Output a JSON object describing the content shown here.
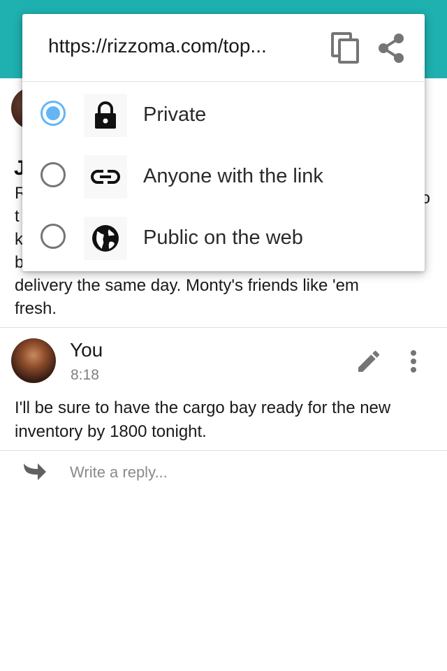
{
  "colors": {
    "appbar": "#1fb0b0",
    "radio_selected": "#64b5f6",
    "radio_unselected": "#757575",
    "icon_dark": "#111111",
    "icon_grey": "#757575"
  },
  "share_popup": {
    "url_display": "https://rizzoma.com/top...",
    "copy_icon": "copy-icon",
    "share_icon": "share-icon",
    "options": [
      {
        "label": "Private",
        "icon": "lock-icon",
        "selected": true
      },
      {
        "label": "Anyone with the link",
        "icon": "link-icon",
        "selected": false
      },
      {
        "label": "Public on the web",
        "icon": "globe-icon",
        "selected": false
      }
    ]
  },
  "message_1": {
    "name_fragment": "J",
    "visible_lines": [
      "R",
      "t",
      "k",
      "b",
      "delivery the same day.  Monty's friends like 'em",
      "fresh."
    ],
    "right_fragment": "o"
  },
  "message_2": {
    "author": "You",
    "time": "8:18",
    "text": "I'll be sure to have the cargo bay ready for the new inventory by 1800 tonight.",
    "edit_icon": "pencil-icon",
    "more_icon": "more-vert-icon"
  },
  "reply": {
    "placeholder": "Write a reply...",
    "icon": "reply-arrow-icon"
  }
}
